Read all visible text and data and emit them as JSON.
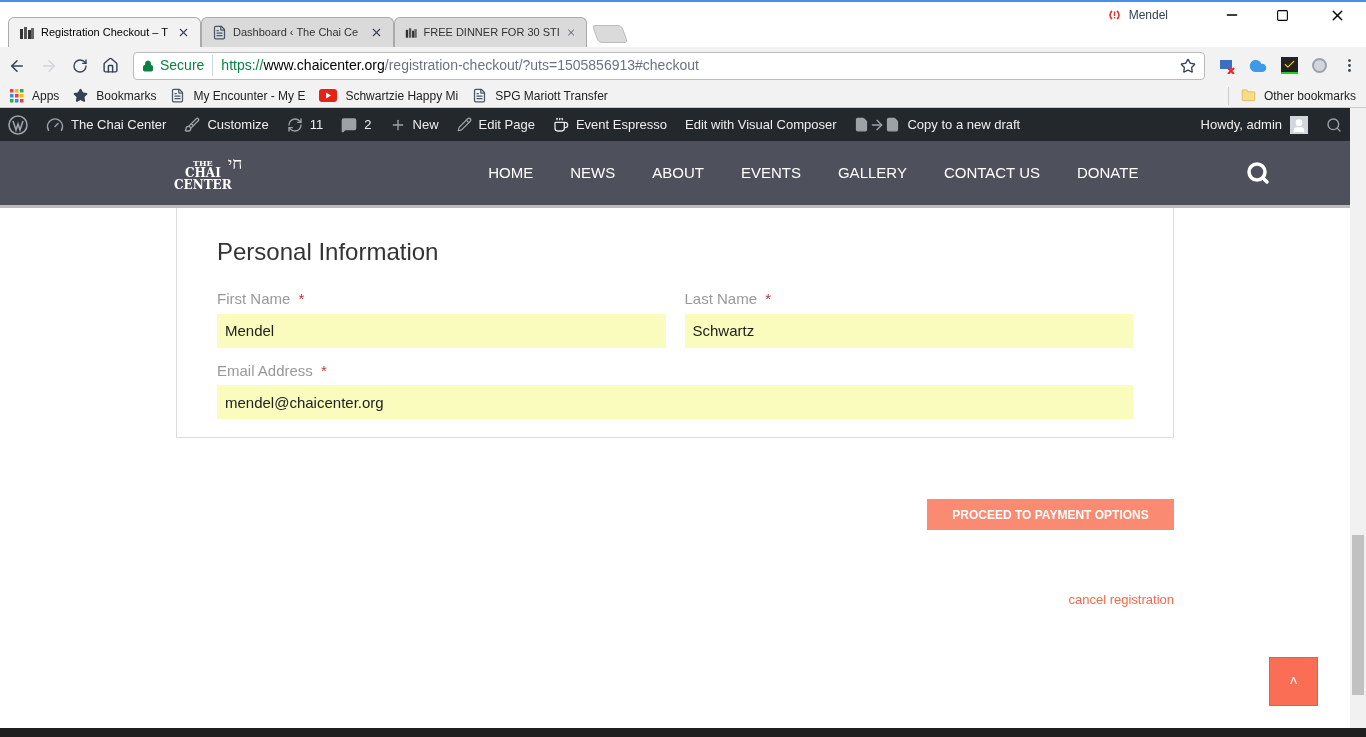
{
  "browser": {
    "tabs": [
      {
        "title": "Registration Checkout – T",
        "kind": "logo",
        "selected": true
      },
      {
        "title": "Dashboard ‹ The Chai Ce",
        "kind": "page",
        "selected": false
      },
      {
        "title": "FREE DINNER FOR 30 STI",
        "kind": "logo",
        "selected": false
      }
    ],
    "profile": "Mendel",
    "address": {
      "secure_label": "Secure",
      "scheme": "https://",
      "host": "www.chaicenter.org",
      "path": "/registration-checkout/?uts=1505856913#checkout"
    },
    "bookmarks": [
      {
        "label": "Apps",
        "kind": "apps"
      },
      {
        "label": "Bookmarks",
        "kind": "star"
      },
      {
        "label": "My Encounter - My E",
        "kind": "page"
      },
      {
        "label": "Schwartzie Happy Mi",
        "kind": "video"
      },
      {
        "label": "SPG Mariott Transfer",
        "kind": "page"
      }
    ],
    "other_bookmarks": "Other bookmarks"
  },
  "admin_bar": {
    "items": [
      {
        "kind": "dashboard",
        "label": "The Chai Center"
      },
      {
        "kind": "brush",
        "label": "Customize"
      },
      {
        "kind": "updates",
        "label": "11"
      },
      {
        "kind": "comments",
        "label": "2"
      },
      {
        "kind": "plus",
        "label": "New"
      },
      {
        "kind": "pencil",
        "label": "Edit Page"
      },
      {
        "kind": "cup",
        "label": "Event Espresso"
      },
      {
        "kind": "none",
        "label": "Edit with Visual Composer"
      },
      {
        "kind": "copy",
        "label": "Copy to a new draft"
      }
    ],
    "greeting": "Howdy, admin"
  },
  "site": {
    "logo": {
      "small": "THE",
      "line1": "CHAI",
      "line2": "CENTER",
      "mark": "חי"
    },
    "nav": [
      "HOME",
      "NEWS",
      "ABOUT",
      "EVENTS",
      "GALLERY",
      "CONTACT US",
      "DONATE"
    ]
  },
  "form": {
    "title": "Personal Information",
    "required_mark": "*",
    "fields": [
      {
        "label": "First Name",
        "value": "Mendel"
      },
      {
        "label": "Last Name",
        "value": "Schwartz"
      },
      {
        "label": "Email Address",
        "value": "mendel@chaicenter.org"
      }
    ],
    "submit": "PROCEED TO PAYMENT OPTIONS",
    "cancel": "cancel registration",
    "back_to_top": "˄"
  }
}
